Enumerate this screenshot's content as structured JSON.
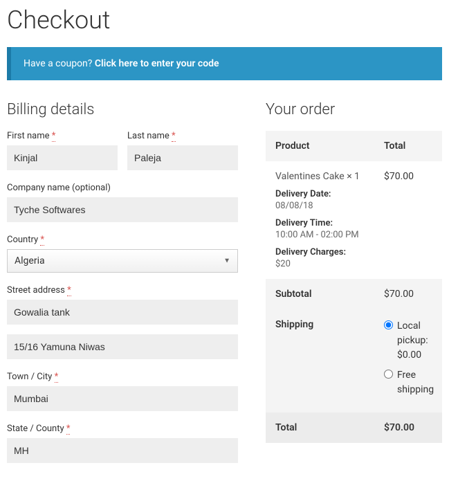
{
  "page_title": "Checkout",
  "coupon": {
    "prompt": "Have a coupon?",
    "link": "Click here to enter your code"
  },
  "billing": {
    "heading": "Billing details",
    "first_name_label": "First name",
    "first_name": "Kinjal",
    "last_name_label": "Last name",
    "last_name": "Paleja",
    "company_label": "Company name (optional)",
    "company": "Tyche Softwares",
    "country_label": "Country",
    "country": "Algeria",
    "street_label": "Street address",
    "street1": "Gowalia tank",
    "street2": "15/16 Yamuna Niwas",
    "city_label": "Town / City",
    "city": "Mumbai",
    "state_label": "State / County",
    "state": "MH"
  },
  "order": {
    "heading": "Your order",
    "product_col": "Product",
    "total_col": "Total",
    "item_name": "Valentines Cake  × 1",
    "item_total": "$70.00",
    "delivery_date_lbl": "Delivery Date:",
    "delivery_date": "08/08/18",
    "delivery_time_lbl": "Delivery Time:",
    "delivery_time": "10:00 AM - 02:00 PM",
    "delivery_charges_lbl": "Delivery Charges:",
    "delivery_charges": "$20",
    "subtotal_lbl": "Subtotal",
    "subtotal": "$70.00",
    "shipping_lbl": "Shipping",
    "ship_opt1": "Local pickup: $0.00",
    "ship_opt2": "Free shipping",
    "total_lbl": "Total",
    "total": "$70.00"
  }
}
